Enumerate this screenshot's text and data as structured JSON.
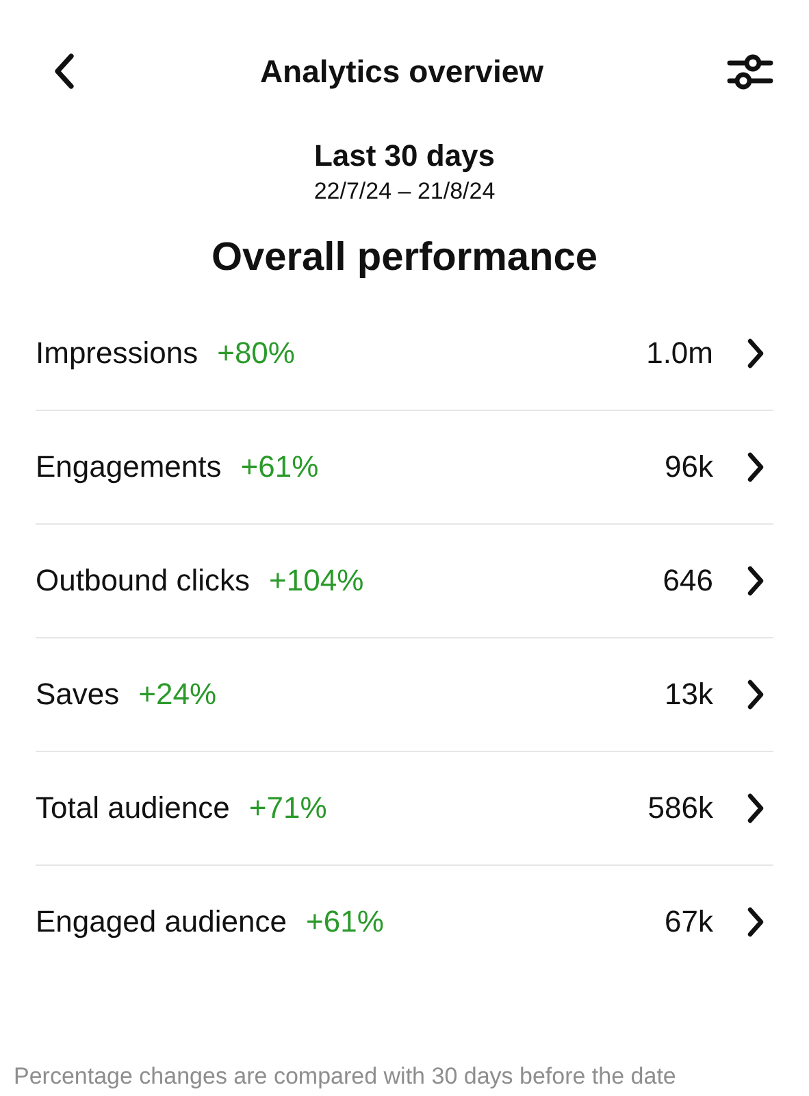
{
  "header": {
    "title": "Analytics overview"
  },
  "period": {
    "label": "Last 30 days",
    "range": "22/7/24 – 21/8/24"
  },
  "section": {
    "title": "Overall performance"
  },
  "metrics": [
    {
      "name": "Impressions",
      "change": "+80%",
      "value": "1.0m"
    },
    {
      "name": "Engagements",
      "change": "+61%",
      "value": "96k"
    },
    {
      "name": "Outbound clicks",
      "change": "+104%",
      "value": "646"
    },
    {
      "name": "Saves",
      "change": "+24%",
      "value": "13k"
    },
    {
      "name": "Total audience",
      "change": "+71%",
      "value": "586k"
    },
    {
      "name": "Engaged audience",
      "change": "+61%",
      "value": "67k"
    }
  ],
  "footnote": "Percentage changes are compared with 30 days before the date"
}
